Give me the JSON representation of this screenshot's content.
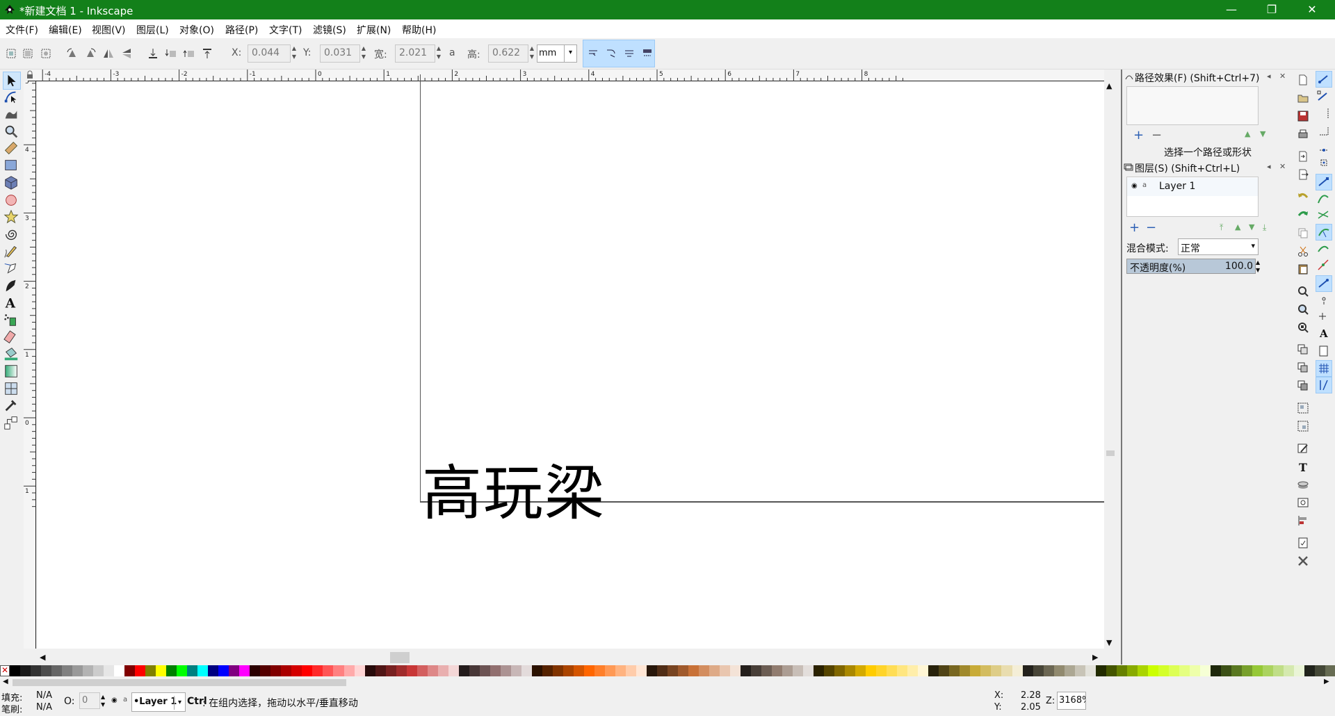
{
  "window": {
    "title": "*新建文档 1 - Inkscape",
    "controls": [
      "—",
      "❐",
      "✕"
    ],
    "titlebar_color": "#13801a"
  },
  "menu": [
    "文件(F)",
    "编辑(E)",
    "视图(V)",
    "图层(L)",
    "对象(O)",
    "路径(P)",
    "文字(T)",
    "滤镜(S)",
    "扩展(N)",
    "帮助(H)"
  ],
  "toolbar": {
    "x_label": "X:",
    "x_value": "0.044",
    "y_label": "Y:",
    "y_value": "0.031",
    "w_label": "宽:",
    "w_value": "2.021",
    "lock_glyph": "a",
    "h_label": "高:",
    "h_value": "0.622",
    "unit": "mm"
  },
  "rulers": {
    "h_ticks": [
      "-4",
      "-3",
      "-2",
      "-1",
      "0",
      "1",
      "2",
      "3",
      "4",
      "5",
      "6",
      "7",
      "8"
    ],
    "v_ticks": [
      "5",
      "4",
      "3",
      "2",
      "1",
      "0",
      "1"
    ]
  },
  "canvas": {
    "text": "高玩梁"
  },
  "path_effects": {
    "title": "路径效果(F) (Shift+Ctrl+7)",
    "hint": "选择一个路径或形状"
  },
  "layers": {
    "title": "图层(S) (Shift+Ctrl+L)",
    "items": [
      "Layer 1"
    ],
    "blend_label": "混合模式:",
    "blend_value": "正常",
    "opacity_label": "不透明度(%)",
    "opacity_value": "100.0"
  },
  "status": {
    "fill_label": "填充:",
    "fill_value": "N/A",
    "stroke_label": "笔刷:",
    "stroke_value": "N/A",
    "o_label": "O:",
    "o_value": "0",
    "layer": "•Layer 1",
    "ctrl_label": "Ctrl",
    "message": ": 在组内选择，拖动以水平/垂直移动",
    "x_label": "X:",
    "x_value": "2.28",
    "y_label": "Y:",
    "y_value": "2.05",
    "z_label": "Z:",
    "zoom": "3168%"
  },
  "icons": {
    "tools": [
      "selector-icon",
      "node-icon",
      "tweak-icon",
      "zoom-icon",
      "measure-icon",
      "rect-icon",
      "3dbox-icon",
      "ellipse-icon",
      "star-icon",
      "spiral-icon",
      "pencil-icon",
      "pen-icon",
      "calligraphy-icon",
      "text-icon",
      "spray-icon",
      "eraser-icon",
      "bucket-icon",
      "gradient-icon",
      "mesh-icon",
      "dropper-icon",
      "connector-icon"
    ]
  },
  "colors": {
    "selected_bg": "#cfe6fb",
    "snap_on": "#bfe0ff",
    "palette": [
      "#000000",
      "#1a1a1a",
      "#333333",
      "#4d4d4d",
      "#666666",
      "#808080",
      "#999999",
      "#b3b3b3",
      "#cccccc",
      "#e6e6e6",
      "#ffffff",
      "#800000",
      "#ff0000",
      "#808000",
      "#ffff00",
      "#008000",
      "#00ff00",
      "#008080",
      "#00ffff",
      "#000080",
      "#0000ff",
      "#800080",
      "#ff00ff",
      "#2b0000",
      "#550000",
      "#800000",
      "#aa0000",
      "#d40000",
      "#ff0000",
      "#ff2a2a",
      "#ff5555",
      "#ff8080",
      "#ffaaaa",
      "#ffd5d5",
      "#280b0b",
      "#501616",
      "#782121",
      "#a02c2c",
      "#c83737",
      "#d35f5f",
      "#de8787",
      "#e9afaf",
      "#f4d7d7",
      "#241c1c",
      "#483737",
      "#6c5353",
      "#916f6f",
      "#ac9393",
      "#c8b7b7",
      "#e3dbdb",
      "#2b1100",
      "#552200",
      "#803300",
      "#aa4400",
      "#d45500",
      "#ff6600",
      "#ff7f2a",
      "#ff9955",
      "#ffb380",
      "#ffccaa",
      "#ffe6d5",
      "#28170b",
      "#502d16",
      "#784421",
      "#a05a2c",
      "#c87137",
      "#d38d5f",
      "#deaa87",
      "#e9c6af",
      "#f4e3d7",
      "#241f1c",
      "#483e37",
      "#6c5d53",
      "#917c6f",
      "#ac9d93",
      "#c8beb7",
      "#e3dedb",
      "#2b2200",
      "#554400",
      "#806600",
      "#aa8800",
      "#d4aa00",
      "#ffcc00",
      "#ffd42a",
      "#ffdd55",
      "#ffe680",
      "#ffeeaa",
      "#fff6d5",
      "#28220b",
      "#504416",
      "#786721",
      "#a0892c",
      "#c8ab37",
      "#d3bc5f",
      "#decd87",
      "#e9ddaf",
      "#f4eed7",
      "#24221c",
      "#484537",
      "#6c6753",
      "#918a6f",
      "#aca793",
      "#c8c4b7",
      "#e3e2db",
      "#222b00",
      "#445500",
      "#668000",
      "#88aa00",
      "#aad400",
      "#ccff00",
      "#d4ff2a",
      "#ddff55",
      "#e5ff80",
      "#eeffaa",
      "#f6ffd5",
      "#1e280b",
      "#3c5016",
      "#5a7821",
      "#78a02c",
      "#96c837",
      "#abd35f",
      "#c0de87",
      "#d5e9af",
      "#eaf4d7",
      "#21241c",
      "#444837",
      "#676c53"
    ]
  }
}
